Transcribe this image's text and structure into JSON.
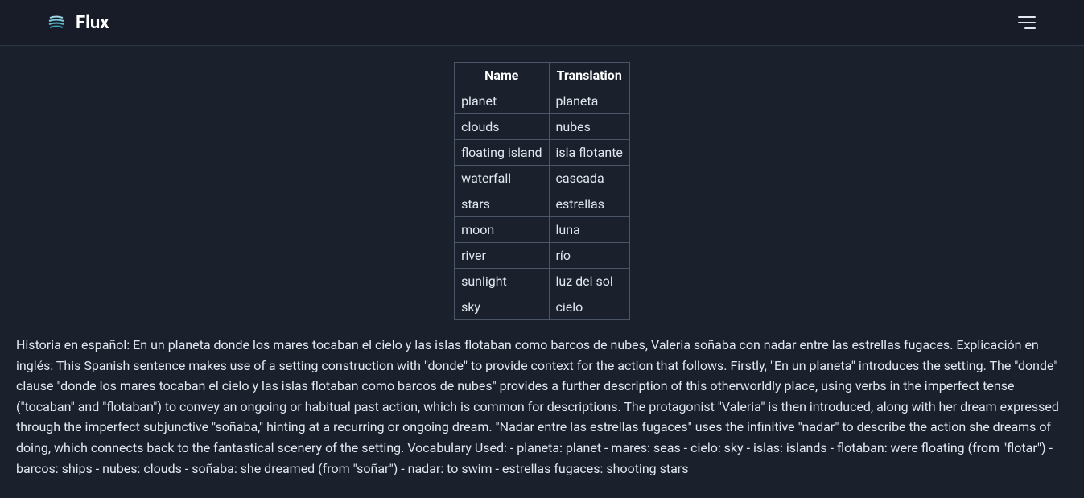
{
  "header": {
    "title": "Flux"
  },
  "table": {
    "headers": [
      "Name",
      "Translation"
    ],
    "rows": [
      [
        "planet",
        "planeta"
      ],
      [
        "clouds",
        "nubes"
      ],
      [
        "floating island",
        "isla flotante"
      ],
      [
        "waterfall",
        "cascada"
      ],
      [
        "stars",
        "estrellas"
      ],
      [
        "moon",
        "luna"
      ],
      [
        "river",
        "río"
      ],
      [
        "sunlight",
        "luz del sol"
      ],
      [
        "sky",
        "cielo"
      ]
    ]
  },
  "paragraph": "Historia en español: En un planeta donde los mares tocaban el cielo y las islas flotaban como barcos de nubes, Valeria soñaba con nadar entre las estrellas fugaces. Explicación en inglés: This Spanish sentence makes use of a setting construction with \"donde\" to provide context for the action that follows. Firstly, \"En un planeta\" introduces the setting. The \"donde\" clause \"donde los mares tocaban el cielo y las islas flotaban como barcos de nubes\" provides a further description of this otherworldly place, using verbs in the imperfect tense (\"tocaban\" and \"flotaban\") to convey an ongoing or habitual past action, which is common for descriptions. The protagonist \"Valeria\" is then introduced, along with her dream expressed through the imperfect subjunctive \"soñaba,\" hinting at a recurring or ongoing dream. \"Nadar entre las estrellas fugaces\" uses the infinitive \"nadar\" to describe the action she dreams of doing, which connects back to the fantastical scenery of the setting. Vocabulary Used: - planeta: planet - mares: seas - cielo: sky - islas: islands - flotaban: were floating (from \"flotar\") - barcos: ships - nubes: clouds - soñaba: she dreamed (from \"soñar\") - nadar: to swim - estrellas fugaces: shooting stars"
}
